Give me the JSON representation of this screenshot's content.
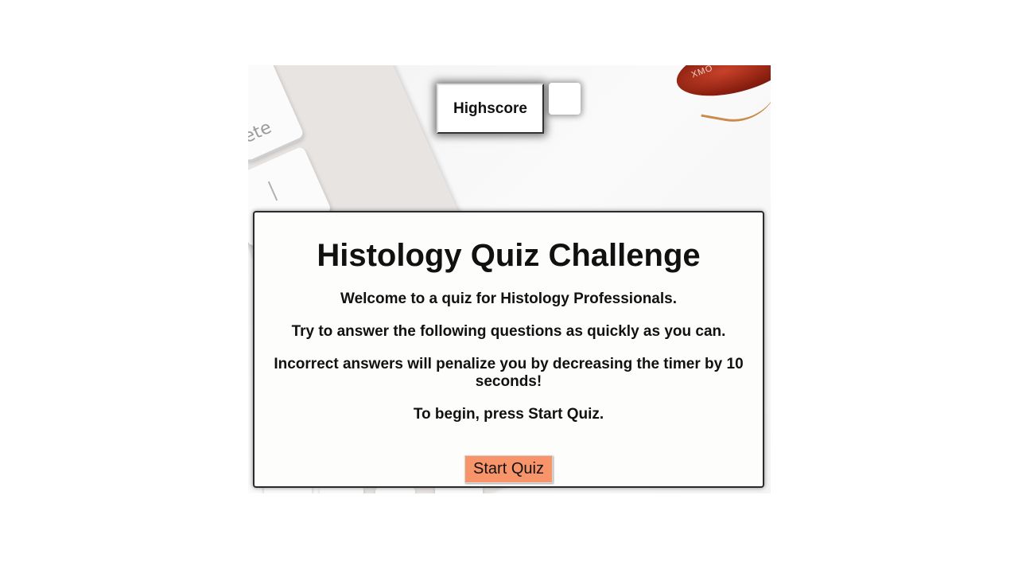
{
  "header": {
    "highscore_label": "Highscore",
    "timer_value": ""
  },
  "background": {
    "key_label": "ete",
    "glasses_brand": "XMO"
  },
  "quiz": {
    "title": "Histology Quiz Challenge",
    "lines": [
      "Welcome to a quiz for Histology Professionals.",
      "Try to answer the following questions as quickly as you can.",
      "Incorrect answers will penalize you by decreasing the timer by 10 seconds!",
      "To begin, press Start Quiz."
    ],
    "start_button_label": "Start Quiz"
  },
  "colors": {
    "start_button": "#f8946a",
    "card_background": "#fdfdfb"
  }
}
